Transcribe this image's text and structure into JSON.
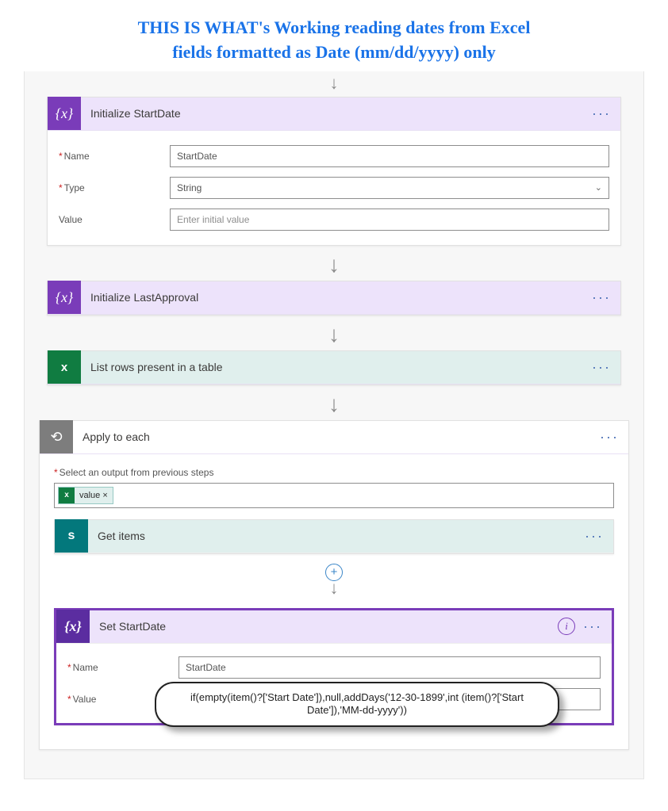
{
  "title_line1": "THIS IS WHAT's Working reading dates from Excel",
  "title_line2": "fields formatted as Date (mm/dd/yyyy) only",
  "steps": {
    "init_start": {
      "title": "Initialize StartDate",
      "name_label": "Name",
      "name_value": "StartDate",
      "type_label": "Type",
      "type_value": "String",
      "value_label": "Value",
      "value_placeholder": "Enter initial value"
    },
    "init_lastapproval": {
      "title": "Initialize LastApproval"
    },
    "list_rows": {
      "title": "List rows present in a table"
    },
    "apply_each": {
      "title": "Apply to each",
      "select_label": "Select an output from previous steps",
      "token_value": "value ×"
    },
    "get_items": {
      "title": "Get items"
    },
    "set_start": {
      "title": "Set StartDate",
      "name_label": "Name",
      "name_value": "StartDate",
      "value_label": "Value",
      "fx_token": "if(...) ×",
      "tooltip": "if(empty(item()?['Start Date']),null,addDays('12-30-1899',int (item()?['Start Date']),'MM-dd-yyyy'))"
    }
  },
  "icons": {
    "var_glyph": "{x}",
    "excel_glyph": "x",
    "loop_glyph": "⟲",
    "sp_glyph": "s",
    "fx_glyph": "fx",
    "info_glyph": "i",
    "menu": "···",
    "arrow": "↓",
    "plus": "+",
    "chevron": "⌄"
  }
}
